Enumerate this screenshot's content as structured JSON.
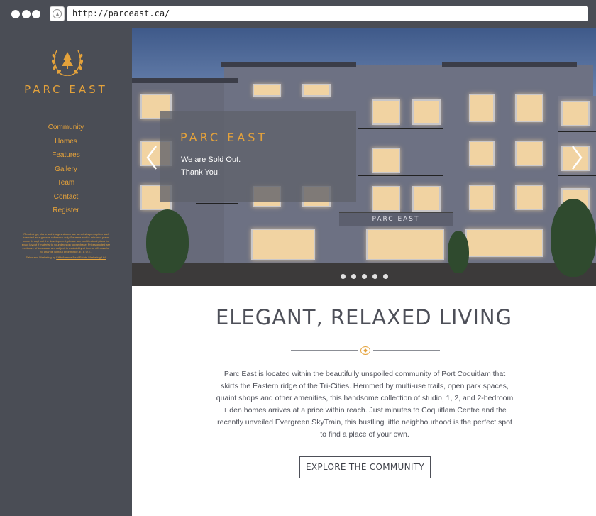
{
  "browser": {
    "url": "http://parceast.ca/"
  },
  "sidebar": {
    "logo_text": "PARC EAST",
    "nav": [
      {
        "label": "Community"
      },
      {
        "label": "Homes"
      },
      {
        "label": "Features"
      },
      {
        "label": "Gallery"
      },
      {
        "label": "Team"
      },
      {
        "label": "Contact"
      },
      {
        "label": "Register"
      }
    ],
    "disclaimer": "Renderings, plans and images shown are an artist's perception and intended as a general reference only. Reverse and/or mirrored plans occur throughout the development, please see architectural plans for exact layout if material to your decision to purchase. Prices quoted are exclusive of taxes and are subject to availability at time of offer and/or to change without prior notice. E. & O.E.",
    "credit_prefix": "Sales and Marketing by",
    "credit_link": "Fifth Avenue Real Estate Marketing Ltd."
  },
  "hero": {
    "caption_brand": "PARC EAST",
    "caption_line1": "We are Sold Out.",
    "caption_line2": "Thank You!",
    "building_sign": "PARC EAST",
    "slide_count": 5,
    "active_slide": 1
  },
  "main": {
    "headline": "ELEGANT, RELAXED LIVING",
    "paragraph": "Parc East is located within the beautifully unspoiled community of Port Coquitlam that skirts the Eastern ridge of the Tri-Cities. Hemmed by multi-use trails, open park spaces, quaint shops and other amenities, this handsome collection of studio, 1, 2, and 2-bedroom + den homes arrives at a price within reach. Just minutes to Coquitlam Centre and the recently unveiled Evergreen SkyTrain, this bustling little neighbourhood is the perfect spot to find a place of your own.",
    "cta_label": "EXPLORE THE COMMUNITY"
  },
  "colors": {
    "accent": "#e4a23b",
    "sidebar_bg": "#4a4d55",
    "text": "#4d4f58"
  }
}
